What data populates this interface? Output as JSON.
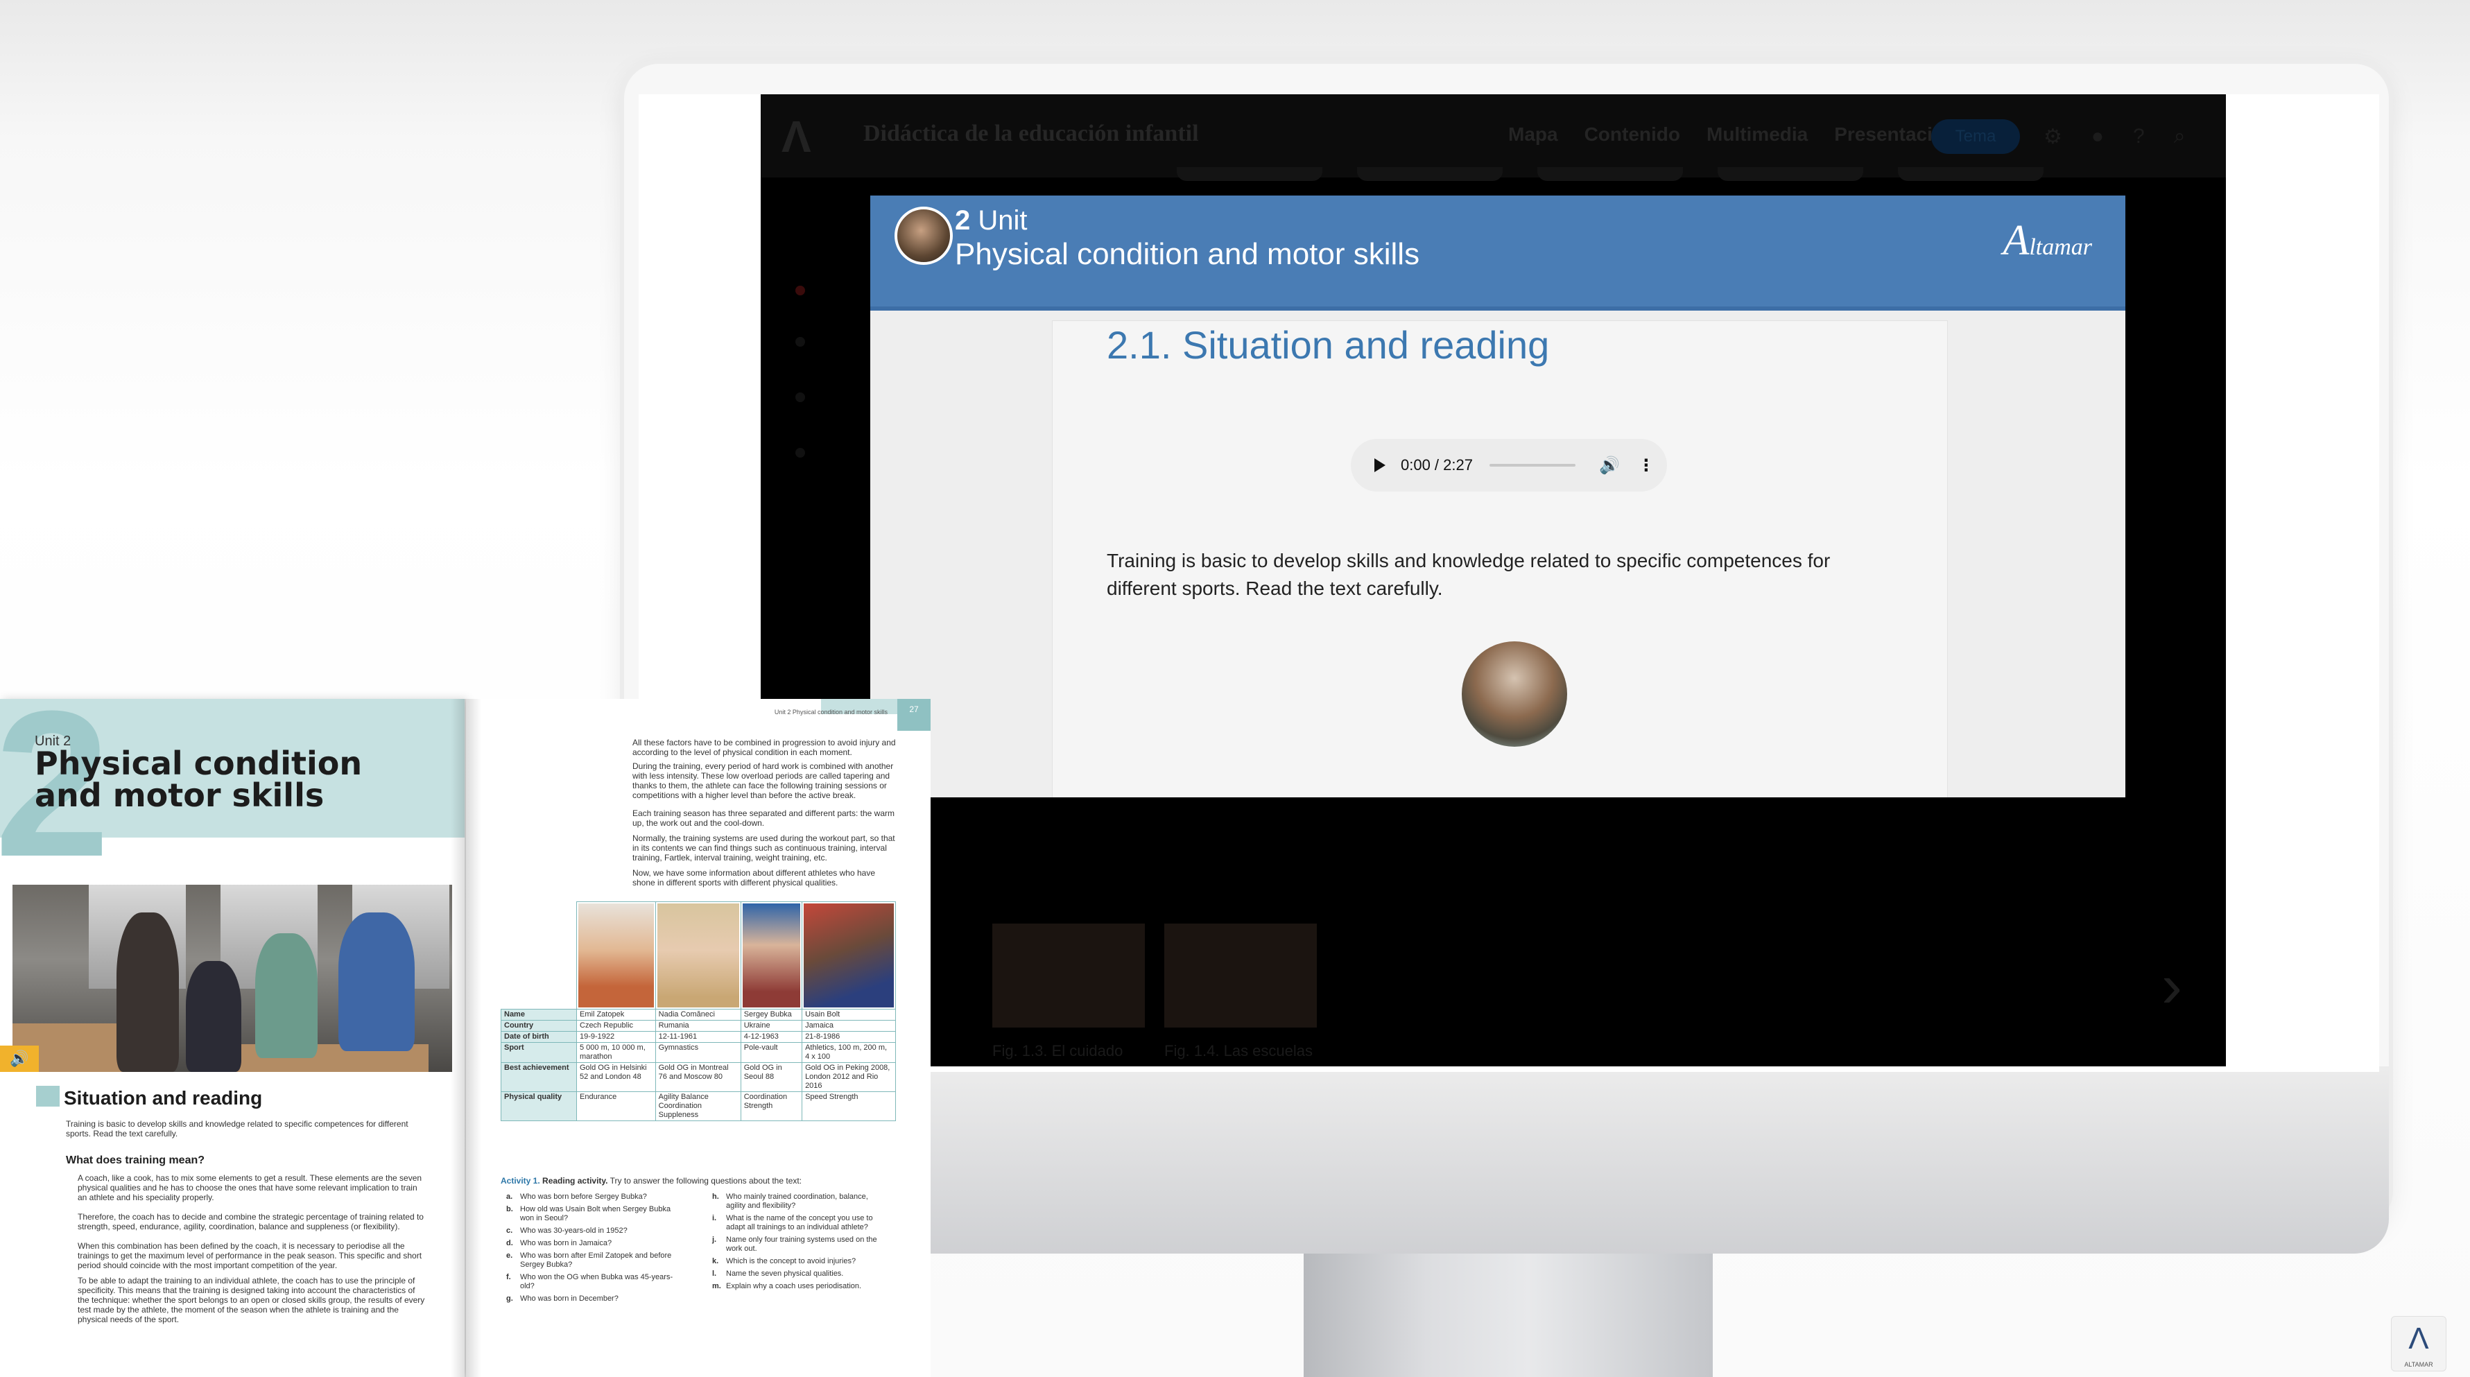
{
  "app": {
    "title": "Didáctica de la educación infantil",
    "logo_glyph": "Λ",
    "nav": [
      "Mapa",
      "Contenido",
      "Multimedia",
      "Presentaciones"
    ],
    "nav_button": "Tema",
    "top_icons": [
      "gear-icon",
      "user-icon",
      "help-icon",
      "search-icon"
    ],
    "thumb_captions": [
      "Fig. 1.3. El cuidado",
      "Fig. 1.4. Las escuelas"
    ]
  },
  "modal": {
    "unit_number": "2",
    "unit_word": "Unit",
    "unit_title": "Physical condition and motor skills",
    "brand": "Altamar",
    "brand_initial": "A",
    "brand_rest": "ltamar",
    "section_title": "2.1. Situation and reading",
    "audio": {
      "time": "0:00 / 2:27",
      "play_glyph": "▶",
      "volume_glyph": "🔊",
      "more_glyph": "⋮"
    },
    "intro": "Training is basic to develop skills and knowledge related to specific competences for different sports. Read the text carefully."
  },
  "book_left": {
    "unit": "Unit 2",
    "digit": "2",
    "title_line1": "Physical condition",
    "title_line2": "and motor skills",
    "sound_badge": "🔊",
    "section": "Situation and reading",
    "intro": "Training is basic to develop skills and knowledge related to specific competences for different sports. Read the text carefully.",
    "subheading": "What does training mean?",
    "paragraphs": [
      "A coach, like a cook, has to mix some elements to get a result. These elements are the seven physical qualities and he has to choose the ones that have some relevant implication to train an athlete and his speciality properly.",
      "Therefore, the coach has to decide and combine the strategic percentage of training related to strength, speed, endurance, agility, coordination, balance and suppleness (or flexibility).",
      "When this combination has been defined by the coach, it is necessary to periodise all the trainings to get the maximum level of performance in the peak season. This specific and short period should coincide with the most important competition of the year.",
      "To be able to adapt the training to an individual athlete, the coach has to use the principle of specificity. This means that the training is designed taking into account the characteristics of the technique: whether the sport belongs to an open or closed skills group, the results of every test made by the athlete, the moment of the season when the athlete is training and the physical needs of the sport."
    ]
  },
  "book_right": {
    "running_head": "Unit 2 Physical condition and motor skills",
    "page_number": "27",
    "paragraphs": [
      "All these factors have to be combined in progression to avoid injury and according to the level of physical condition in each moment.",
      "During the training, every period of hard work is combined with another with less intensity. These low overload periods are called tapering and thanks to them, the athlete can face the following training sessions or competitions with a higher level than before the active break.",
      "Each training season has three separated and different parts: the warm up, the work out and the cool-down.",
      "Normally, the training systems are used during the workout part, so that in its contents we can find things such as continuous training, interval training, Fartlek, interval training, weight training, etc.",
      "Now, we have some information about different athletes who have shone in different sports with different physical qualities."
    ],
    "table": {
      "row_labels": [
        "Name",
        "Country",
        "Date of birth",
        "Sport",
        "Best achievement",
        "Physical quality"
      ],
      "athletes": [
        {
          "name": "Emil Zatopek",
          "country": "Czech Republic",
          "dob": "19-9-1922",
          "sport": "5 000 m, 10 000 m, marathon",
          "best": "Gold OG in Helsinki 52 and London 48",
          "quality": "Endurance",
          "color": "#c4653a"
        },
        {
          "name": "Nadia Comăneci",
          "country": "Rumania",
          "dob": "12-11-1961",
          "sport": "Gymnastics",
          "best": "Gold OG in Montreal 76 and Moscow 80",
          "quality": "Agility Balance Coordination Suppleness",
          "color": "#c9a774"
        },
        {
          "name": "Sergey Bubka",
          "country": "Ukraine",
          "dob": "4-12-1963",
          "sport": "Pole-vault",
          "best": "Gold OG in Seoul 88",
          "quality": "Coordination Strength",
          "color": "#8e3b36"
        },
        {
          "name": "Usain Bolt",
          "country": "Jamaica",
          "dob": "21-8-1986",
          "sport": "Athletics, 100 m, 200 m, 4 x 100",
          "best": "Gold OG in Peking 2008, London 2012 and Rio 2016",
          "quality": "Speed Strength",
          "color": "#b4462f"
        }
      ]
    },
    "activity_label": "Activity 1.",
    "activity_title": "Reading activity.",
    "activity_text": "Try to answer the following questions about the text:",
    "questions_left": [
      {
        "k": "a.",
        "t": "Who was born before Sergey Bubka?"
      },
      {
        "k": "b.",
        "t": "How old was Usain Bolt when Sergey Bubka won in Seoul?"
      },
      {
        "k": "c.",
        "t": "Who was 30-years-old in 1952?"
      },
      {
        "k": "d.",
        "t": "Who was born in Jamaica?"
      },
      {
        "k": "e.",
        "t": "Who was born after Emil Zatopek and before Sergey Bubka?"
      },
      {
        "k": "f.",
        "t": "Who won the OG when Bubka was 45-years-old?"
      },
      {
        "k": "g.",
        "t": "Who was born in December?"
      }
    ],
    "questions_right": [
      {
        "k": "h.",
        "t": "Who mainly trained coordination, balance, agility and flexibility?"
      },
      {
        "k": "i.",
        "t": "What is the name of the concept you use to adapt all trainings to an individual athlete?"
      },
      {
        "k": "j.",
        "t": "Name only four training systems used on the work out."
      },
      {
        "k": "k.",
        "t": "Which is the concept to avoid injuries?"
      },
      {
        "k": "l.",
        "t": "Name the seven physical qualities."
      },
      {
        "k": "m.",
        "t": "Explain why a coach uses periodisation."
      }
    ]
  },
  "corner_logo": {
    "glyph": "Λ",
    "caption": "ALTAMAR"
  }
}
